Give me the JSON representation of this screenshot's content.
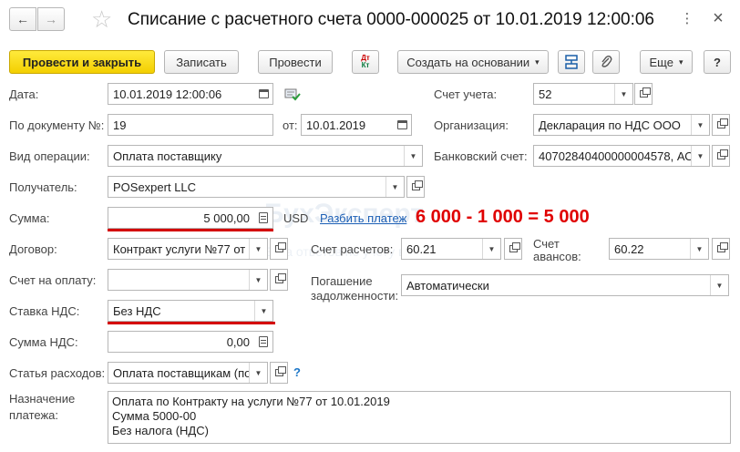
{
  "header": {
    "title": "Списание с расчетного счета 0000-000025 от 10.01.2019 12:00:06",
    "back_glyph": "←",
    "forward_glyph": "→",
    "star_glyph": "☆",
    "more_glyph": "⋮",
    "close_glyph": "×"
  },
  "toolbar": {
    "post_close": "Провести и закрыть",
    "save": "Записать",
    "post": "Провести",
    "dtkt_top": "Дт",
    "dtkt_bottom": "Кт",
    "create_based_on": "Создать на основании",
    "more": "Еще",
    "help": "?",
    "dropdown_glyph": "▾"
  },
  "watermark": {
    "main": "БухЭксперт",
    "sub": "База ответов по учету в 1С"
  },
  "form": {
    "date_label": "Дата:",
    "date_value": "10.01.2019 12:00:06",
    "doc_label": "По документу №:",
    "doc_number": "19",
    "doc_from_label": "от:",
    "doc_date": "10.01.2019",
    "op_type_label": "Вид операции:",
    "op_type_value": "Оплата поставщику",
    "recipient_label": "Получатель:",
    "recipient_value": "POSexpert LLC",
    "amount_label": "Сумма:",
    "amount_value": "5 000,00",
    "currency": "USD",
    "split_link": "Разбить платеж",
    "annotation": "6 000 - 1 000 = 5 000",
    "contract_label": "Договор:",
    "contract_value": "Контракт услуги №77 от",
    "invoice_label": "Счет на оплату:",
    "invoice_value": "",
    "vat_rate_label": "Ставка НДС:",
    "vat_rate_value": "Без НДС",
    "vat_sum_label": "Сумма НДС:",
    "vat_sum_value": "0,00",
    "expense_label": "Статья расходов:",
    "expense_value": "Оплата поставщикам (по",
    "purpose_label_1": "Назначение",
    "purpose_label_2": "платежа:",
    "purpose_lines": [
      "Оплата по Контракту на услуги №77 от 10.01.2019",
      "Сумма 5000-00",
      "Без налога (НДС)"
    ],
    "account_label": "Счет учета:",
    "account_value": "52",
    "org_label": "Организация:",
    "org_value": "Декларация по НДС ООО",
    "bank_label": "Банковский счет:",
    "bank_value": "40702840400000004578, АО",
    "settle_label": "Счет расчетов:",
    "settle_value": "60.21",
    "advance_label_1": "Счет",
    "advance_label_2": "авансов:",
    "advance_value": "60.22",
    "repay_label_1": "Погашение",
    "repay_label_2": "задолженности:",
    "repay_value": "Автоматически",
    "help_glyph": "?"
  },
  "colors": {
    "primary_button": "#f3cf00",
    "annotation": "#e00000",
    "link": "#1c5fb5"
  }
}
